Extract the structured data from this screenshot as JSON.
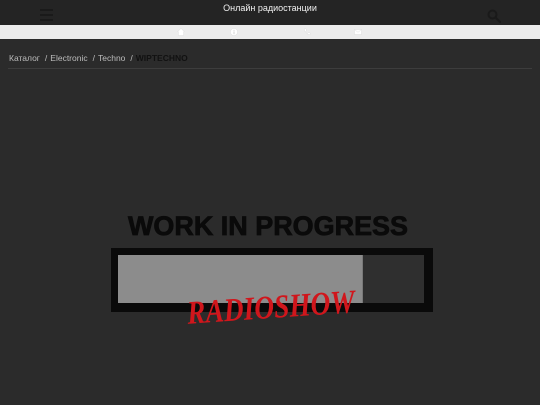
{
  "header": {
    "title": "Онлайн радиостанции",
    "menu_icon": "hamburger-icon",
    "search_icon": "search-icon"
  },
  "contact_bar": {
    "icons": [
      "home-icon",
      "info-icon",
      "phone-icon",
      "mail-icon"
    ]
  },
  "breadcrumb": {
    "items": [
      "Каталог",
      "Electronic",
      "Techno"
    ],
    "current": "WIPTECHNO"
  },
  "station": {
    "cover_title": "WORK IN PROGRESS",
    "cover_subtitle": "RADIOSHOW",
    "progress": 0.8
  },
  "colors": {
    "background": "#2b2b2b",
    "bar": "#242424",
    "icon_bar": "#ececec",
    "accent_red": "#d0161c"
  }
}
